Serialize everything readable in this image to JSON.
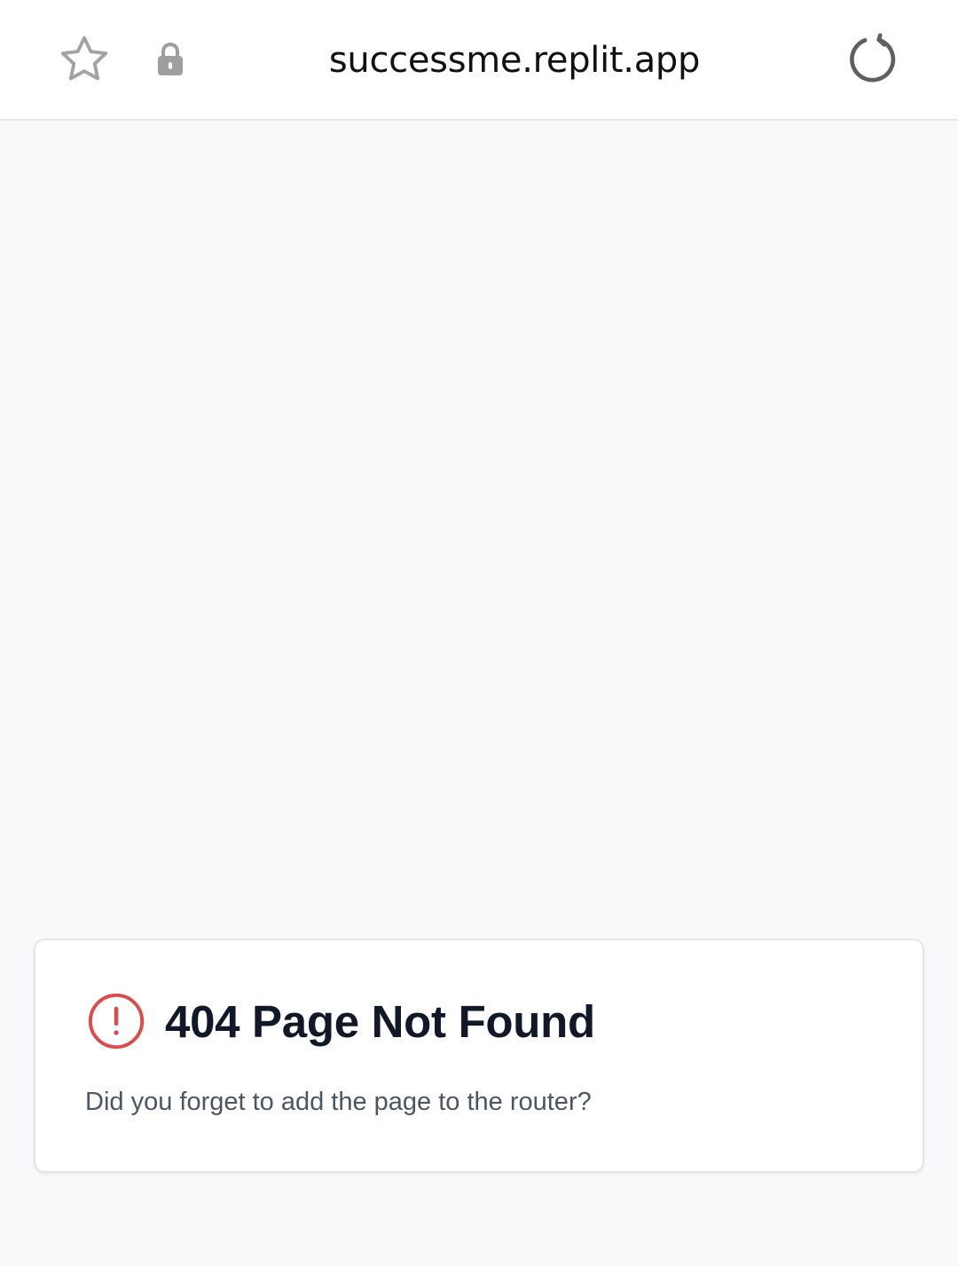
{
  "browser": {
    "url": "successme.replit.app",
    "icons": {
      "bookmark": "star-icon",
      "security": "lock-icon",
      "reload": "reload-icon"
    }
  },
  "error_card": {
    "title": "404 Page Not Found",
    "description": "Did you forget to add the page to the router?",
    "icon": "alert-circle-icon"
  },
  "colors": {
    "page_background": "#f8f9fa",
    "card_background": "#ffffff",
    "alert_red": "#dc4c4c",
    "title_text": "#111827",
    "description_text": "#4b5563"
  }
}
